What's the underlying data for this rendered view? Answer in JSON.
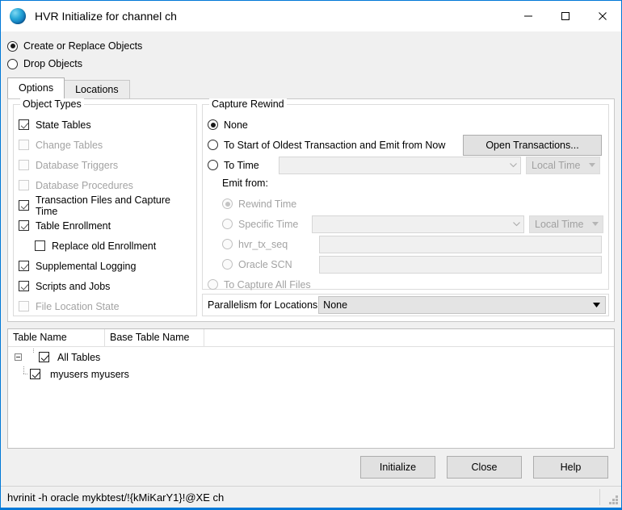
{
  "window": {
    "title": "HVR Initialize for channel ch",
    "icon": "hvr-sphere-icon",
    "accent_color": "#0078d7",
    "controls": {
      "minimize": "minimize-icon",
      "maximize": "maximize-icon",
      "close": "close-icon"
    }
  },
  "mode": {
    "create_label": "Create or Replace Objects",
    "drop_label": "Drop Objects",
    "selected": "create"
  },
  "tabs": [
    {
      "label": "Options",
      "active": true
    },
    {
      "label": "Locations",
      "active": false
    }
  ],
  "object_types": {
    "legend": "Object Types",
    "items": [
      {
        "label": "State Tables",
        "checked": true,
        "enabled": true,
        "indent": false
      },
      {
        "label": "Change Tables",
        "checked": false,
        "enabled": false,
        "indent": false
      },
      {
        "label": "Database Triggers",
        "checked": false,
        "enabled": false,
        "indent": false
      },
      {
        "label": "Database Procedures",
        "checked": false,
        "enabled": false,
        "indent": false
      },
      {
        "label": "Transaction Files and Capture Time",
        "checked": true,
        "enabled": true,
        "indent": false
      },
      {
        "label": "Table Enrollment",
        "checked": true,
        "enabled": true,
        "indent": false
      },
      {
        "label": "Replace old Enrollment",
        "checked": false,
        "enabled": true,
        "indent": true
      },
      {
        "label": "Supplemental Logging",
        "checked": true,
        "enabled": true,
        "indent": false
      },
      {
        "label": "Scripts and Jobs",
        "checked": true,
        "enabled": true,
        "indent": false
      },
      {
        "label": "File Location State",
        "checked": false,
        "enabled": false,
        "indent": false
      }
    ]
  },
  "capture_rewind": {
    "legend": "Capture Rewind",
    "none_label": "None",
    "oldest_label": "To Start of Oldest Transaction and Emit from Now",
    "open_transactions_button": "Open Transactions...",
    "to_time_label": "To Time",
    "to_time_value": "",
    "to_time_placeholder": "",
    "to_time_zone": "Local Time",
    "emit_from_label": "Emit from:",
    "rewind_time_label": "Rewind Time",
    "specific_time_label": "Specific Time",
    "specific_time_value": "",
    "specific_time_zone": "Local Time",
    "hvr_tx_seq_label": "hvr_tx_seq",
    "hvr_tx_seq_value": "",
    "oracle_scn_label": "Oracle SCN",
    "oracle_scn_value": "",
    "capture_all_files_label": "To Capture All Files",
    "selected": "none"
  },
  "parallelism": {
    "label": "Parallelism for Locations",
    "value": "None"
  },
  "table": {
    "columns": [
      "Table Name",
      "Base Table Name",
      ""
    ],
    "rows": [
      {
        "label": "All Tables",
        "checked": true,
        "level": 0,
        "expander": "minus"
      },
      {
        "label": "myusers myusers",
        "checked": true,
        "level": 1,
        "expander": "none"
      }
    ]
  },
  "buttons": {
    "initialize": "Initialize",
    "close": "Close",
    "help": "Help"
  },
  "statusbar": {
    "command": "hvrinit -h oracle mykbtest/!{kMiKarY1}!@XE ch"
  }
}
